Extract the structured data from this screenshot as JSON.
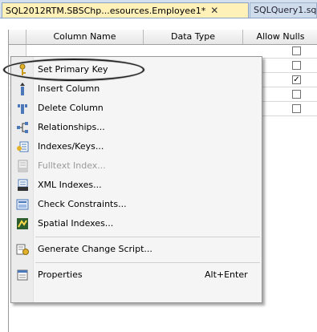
{
  "tabs": [
    {
      "label": "SQL2012RTM.SBSChp...esources.Employee1*",
      "close": "✕"
    },
    {
      "label": "SQLQuery1.sq"
    }
  ],
  "grid": {
    "headers": [
      "Column Name",
      "Data Type",
      "Allow Nulls"
    ],
    "allow_nulls": [
      false,
      false,
      true,
      false,
      false
    ]
  },
  "menu": {
    "items": [
      {
        "label": "Set Primary Key",
        "icon": "key-icon",
        "enabled": true
      },
      {
        "label": "Insert Column",
        "icon": "insert-column-icon",
        "enabled": true
      },
      {
        "label": "Delete Column",
        "icon": "delete-column-icon",
        "enabled": true
      },
      {
        "label": "Relationships...",
        "icon": "relationships-icon",
        "enabled": true
      },
      {
        "label": "Indexes/Keys...",
        "icon": "indexes-keys-icon",
        "enabled": true
      },
      {
        "label": "Fulltext Index...",
        "icon": "fulltext-index-icon",
        "enabled": false
      },
      {
        "label": "XML Indexes...",
        "icon": "xml-indexes-icon",
        "enabled": true
      },
      {
        "label": "Check Constraints...",
        "icon": "check-constraints-icon",
        "enabled": true
      },
      {
        "label": "Spatial Indexes...",
        "icon": "spatial-indexes-icon",
        "enabled": true
      },
      {
        "label": "Generate Change Script...",
        "icon": "generate-script-icon",
        "enabled": true
      },
      {
        "label": "Properties",
        "shortcut": "Alt+Enter",
        "icon": "properties-icon",
        "enabled": true
      }
    ]
  },
  "colors": {
    "active_tab": "#fff1b8",
    "menu_bg": "#f5f5f5"
  }
}
